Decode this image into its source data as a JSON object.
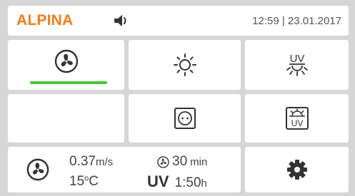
{
  "header": {
    "brand": "ALPINA",
    "brand_color": "#f07d19",
    "speaker_icon": "speaker-icon",
    "datetime": "12:59 | 23.01.2017"
  },
  "tiles": [
    {
      "name": "fan",
      "icon": "fan-icon",
      "active": true
    },
    {
      "name": "light",
      "icon": "sun-icon"
    },
    {
      "name": "uv-lamp",
      "icon": "uv-lamp-icon",
      "label": "UV"
    },
    {
      "name": "empty"
    },
    {
      "name": "socket",
      "icon": "socket-icon"
    },
    {
      "name": "uv-box",
      "icon": "uv-box-icon",
      "label": "UV"
    },
    {
      "name": "settings",
      "icon": "gear-icon"
    }
  ],
  "status": {
    "speed_value": "0.37",
    "speed_unit": "m/s",
    "temp_value": "15",
    "temp_degree": "o",
    "temp_unit": "C",
    "timer_value": "30",
    "timer_unit": "min",
    "uv_label": "UV",
    "uv_time_value": "1:50",
    "uv_time_unit": "h"
  },
  "colors": {
    "accent_green": "#4cc53a",
    "icon_dark": "#333333",
    "background": "#d6d6d6",
    "panel": "#ffffff"
  }
}
